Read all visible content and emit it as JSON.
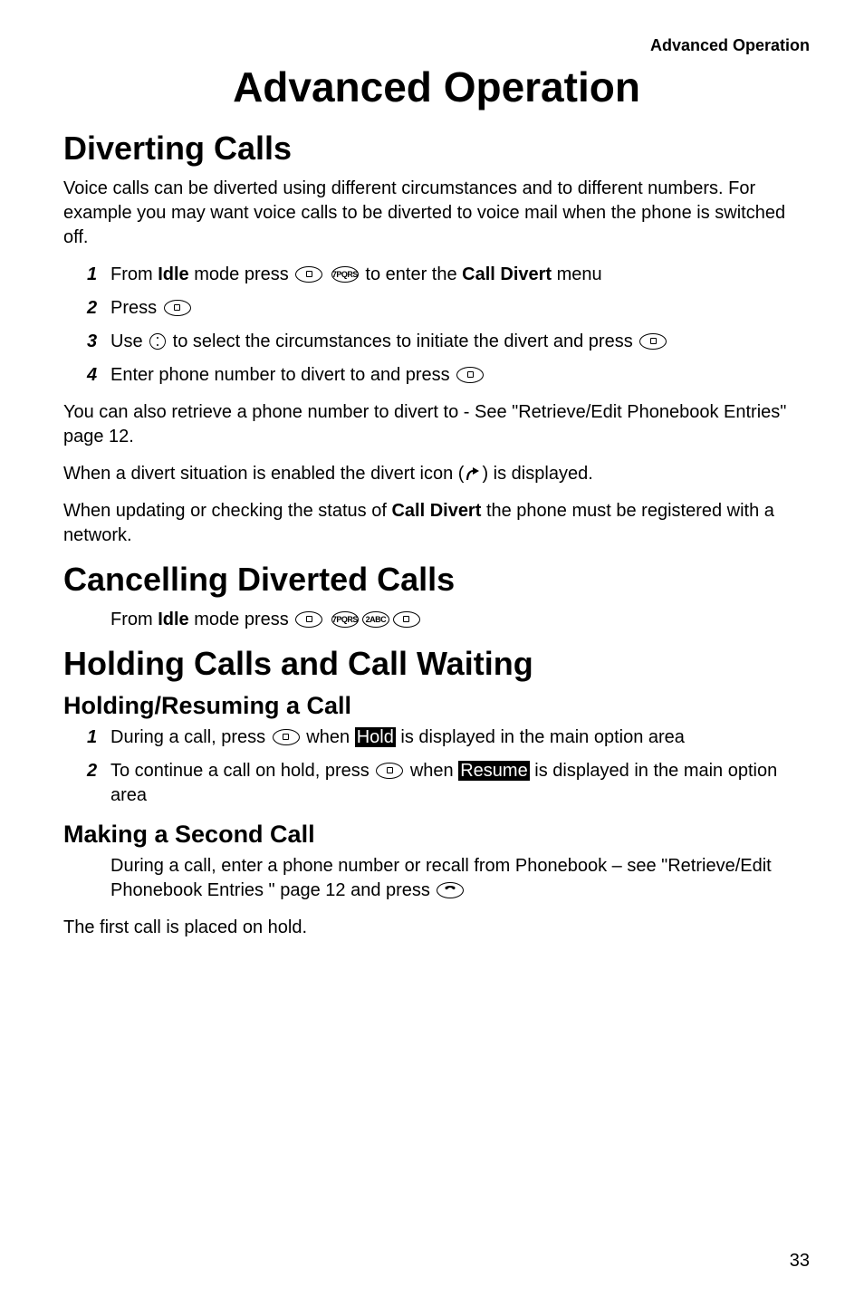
{
  "header": {
    "section": "Advanced Operation"
  },
  "chapterTitle": "Advanced Operation",
  "sections": {
    "diverting": {
      "title": "Diverting Calls",
      "intro": "Voice calls can be diverted using different circumstances and to different numbers. For example you may want voice calls to be diverted to voice mail when the phone is switched off.",
      "steps": {
        "s1a": "From ",
        "s1b": "Idle",
        "s1c": " mode press ",
        "s1d": " to enter the ",
        "s1e": "Call Divert",
        "s1f": " menu",
        "s2a": "Press ",
        "s3a": "Use ",
        "s3b": " to select the circumstances to initiate the divert and press ",
        "s4a": "Enter phone number to divert to and press "
      },
      "after1": "You can also retrieve a phone number to divert to - See \"Retrieve/Edit Phonebook Entries\" page 12.",
      "after2a": "When a divert situation is enabled the divert icon (",
      "after2b": ") is displayed.",
      "after3a": "When updating or checking the status of ",
      "after3b": "Call Divert",
      "after3c": " the phone must be registered with a network."
    },
    "cancelling": {
      "title": "Cancelling Diverted Calls",
      "body1a": "From ",
      "body1b": "Idle",
      "body1c": " mode press "
    },
    "holding": {
      "title": "Holding Calls and Call Waiting",
      "sub1": {
        "title": "Holding/Resuming a Call",
        "s1a": "During a call, press ",
        "s1b": " when ",
        "s1c": "Hold",
        "s1d": " is displayed in the main option area",
        "s2a": "To continue a call on hold, press ",
        "s2b": " when ",
        "s2c": "Resume",
        "s2d": " is displayed in the main option area"
      },
      "sub2": {
        "title": "Making a Second Call",
        "body1": "During a call, enter a phone number or recall from Phonebook  – see \"Retrieve/Edit Phonebook Entries \" page 12 and press ",
        "body2": "The first call is placed on hold."
      }
    }
  },
  "icons": {
    "btn7": "7PQRS",
    "btn2": "2ABC"
  },
  "pageNumber": "33"
}
